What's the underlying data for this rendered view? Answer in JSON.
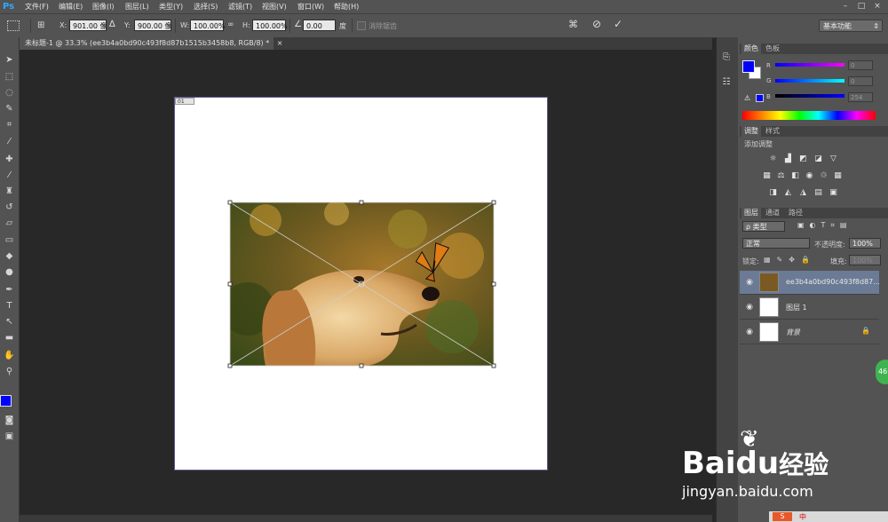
{
  "app": {
    "logo": "Ps"
  },
  "menu": [
    "文件(F)",
    "编辑(E)",
    "图像(I)",
    "图层(L)",
    "类型(Y)",
    "选择(S)",
    "滤镜(T)",
    "视图(V)",
    "窗口(W)",
    "帮助(H)"
  ],
  "window_controls": {
    "minimize": "–",
    "maximize": "□",
    "close": "×"
  },
  "options": {
    "x_label": "X:",
    "x_value": "901.00 像",
    "y_label": "Y:",
    "y_value": "900.00 像",
    "w_label": "W:",
    "w_value": "100.00%",
    "h_label": "H:",
    "h_value": "100.00%",
    "angle_value": "0.00",
    "angle_unit": "度",
    "antialias_label": "消除锯齿",
    "workspace": "基本功能"
  },
  "document_tab": {
    "title": "未标题-1 @ 33.3% (ee3b4a0bd90c493f8d87b1515b3458b8, RGB/8) *",
    "close": "×"
  },
  "page_corner_label": "01",
  "color_panel": {
    "tabs": [
      "颜色",
      "色板"
    ],
    "r_label": "R",
    "r_value": "0",
    "g_label": "G",
    "g_value": "0",
    "b_label": "B",
    "b_value": "254",
    "foreground": "#0000fe",
    "background": "#ffffff"
  },
  "adjustments_panel": {
    "tabs": [
      "调整",
      "样式"
    ],
    "heading": "添加调整"
  },
  "layers_panel": {
    "tabs": [
      "图层",
      "通道",
      "路径"
    ],
    "filter": "ρ 类型",
    "blend_mode": "正常",
    "opacity_label": "不透明度:",
    "opacity_value": "100%",
    "lock_label": "锁定:",
    "fill_label": "填充:",
    "fill_value": "100%",
    "layers": [
      {
        "name": "ee3b4a0bd90c493f8d87...",
        "selected": true
      },
      {
        "name": "图层 1",
        "selected": false
      },
      {
        "name": "背景",
        "selected": false,
        "locked": true
      }
    ]
  },
  "badge": "46",
  "watermark": {
    "brand_left": "Bai",
    "brand_paw": "du",
    "brand_right": "经验",
    "url": "jingyan.baidu.com"
  },
  "tray": {
    "ime": "中"
  }
}
